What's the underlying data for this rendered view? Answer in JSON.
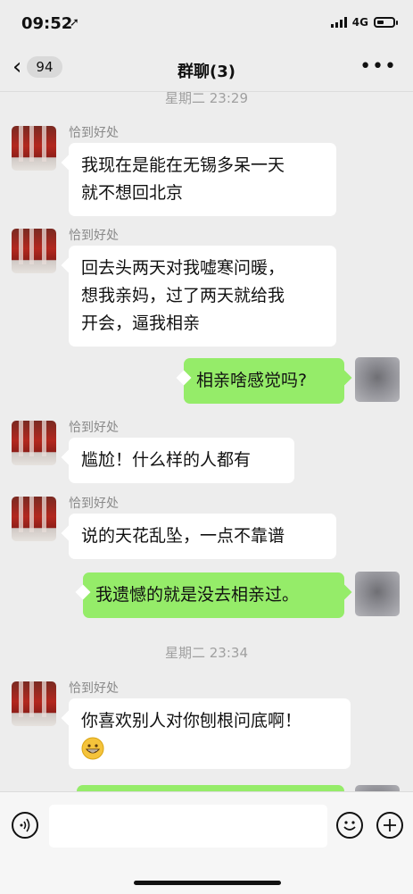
{
  "status_bar": {
    "time": "09:52",
    "network": "4G"
  },
  "nav": {
    "back_badge": "94",
    "title": "群聊(3)",
    "more_icon": "ellipsis-icon"
  },
  "chat": {
    "timestamp_1": "星期二 23:29",
    "timestamp_2": "星期二 23:34",
    "messages": [
      {
        "sender": "恰到好处",
        "lines": [
          "我现在是能在无锡多呆一天",
          "就不想回北京"
        ]
      },
      {
        "sender": "恰到好处",
        "lines": [
          "回去头两天对我嘘寒问暖，",
          "想我亲妈，过了两天就给我",
          "开会，逼我相亲"
        ]
      },
      {
        "sender": "me",
        "lines": [
          "相亲啥感觉吗?"
        ]
      },
      {
        "sender": "恰到好处",
        "lines": [
          "尴尬！什么样的人都有"
        ]
      },
      {
        "sender": "恰到好处",
        "lines": [
          "说的天花乱坠，一点不靠谱"
        ]
      },
      {
        "sender": "me",
        "lines": [
          "我遗憾的就是没去相亲过。"
        ]
      },
      {
        "sender": "恰到好处",
        "lines": [
          "你喜欢别人对你刨根问底啊！"
        ],
        "emoji": "grinning-face-emoji"
      }
    ]
  },
  "input_bar": {
    "voice_icon": "voice-icon",
    "emoji_icon": "emoji-smile-icon",
    "plus_icon": "plus-icon"
  },
  "colors": {
    "background": "#ededed",
    "my_bubble": "#95ec69",
    "other_bubble": "#ffffff"
  }
}
